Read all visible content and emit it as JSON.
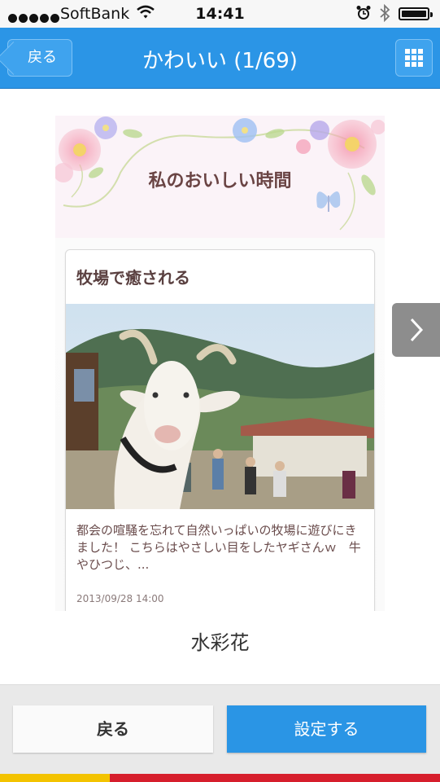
{
  "status_bar": {
    "carrier": "SoftBank",
    "time": "14:41",
    "icons": [
      "signal-dots-icon",
      "wifi-icon",
      "alarm-icon",
      "bluetooth-icon",
      "battery-icon"
    ]
  },
  "nav": {
    "back_label": "戻る",
    "title": "かわいい (1/69)",
    "grid_icon": "grid-icon"
  },
  "preview": {
    "header_title": "私のおいしい時間",
    "card": {
      "title": "牧場で癒される",
      "text": "都会の喧騒を忘れて自然いっぱいの牧場に遊びにきました！ こちらはやさしい目をしたヤギさんｗ　牛やひつじ、...",
      "date": "2013/09/28 14:00"
    }
  },
  "theme_name": "水彩花",
  "buttons": {
    "back": "戻る",
    "set": "設定する"
  },
  "colors": {
    "accent": "#2b95e6",
    "bottom_strip_yellow": "#f3c300",
    "bottom_strip_red": "#d61e2c"
  }
}
